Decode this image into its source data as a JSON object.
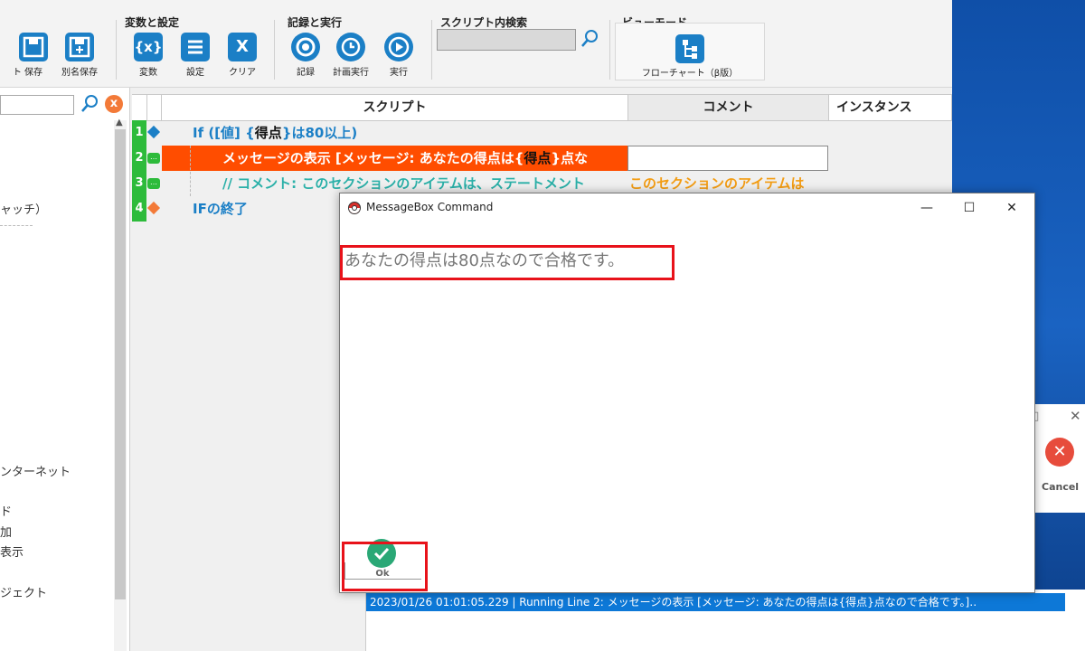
{
  "ribbon": {
    "groups": {
      "variables": "変数と設定",
      "record_run": "記録と実行",
      "search": "スクリプト内検索",
      "view": "ビューモード"
    },
    "buttons": {
      "partial_left": "ト",
      "save": "保存",
      "save_as": "別名保存",
      "variables": "変数",
      "settings": "設定",
      "clear": "クリア",
      "record": "記録",
      "schedule": "計画実行",
      "run": "実行",
      "flowchart": "フローチャート（β版）"
    },
    "icons": {
      "variables": "{x}",
      "clear": "X"
    }
  },
  "left_panel": {
    "items": [
      "ャッチ）",
      "ンターネット",
      "ド",
      "加",
      "表示",
      "ジェクト"
    ]
  },
  "grid": {
    "headers": {
      "script": "スクリプト",
      "comment": "コメント",
      "instance": "インスタンス"
    },
    "rows": [
      {
        "num": "1",
        "text_a": "If ([値] {",
        "text_b": "得点",
        "text_c": "}は80以上)"
      },
      {
        "num": "2",
        "text_a": "メッセージの表示 [メッセージ: あなたの得点は{",
        "text_b": "得点",
        "text_c": "}点な"
      },
      {
        "num": "3",
        "text_a": "// コメント: このセクションのアイテムは、ステートメント",
        "comment": "このセクションのアイテムは"
      },
      {
        "num": "4",
        "text_a": "IFの終了"
      }
    ]
  },
  "message_box": {
    "title": "MessageBox Command",
    "message": "あなたの得点は80点なので合格です。",
    "ok_label": "Ok"
  },
  "background_dialog": {
    "cancel_label": "Cancel"
  },
  "log": {
    "line": "2023/01/26 01:01:05.229 | Running Line 2: メッセージの表示 [メッセージ: あなたの得点は{得点}点なので合格です。]‥"
  },
  "colors": {
    "accent_blue": "#1b7fc6",
    "line_green": "#2dbb3b",
    "highlight_orange": "#ff4d00",
    "comment_teal": "#2ab0a8",
    "annotation_red": "#e8121a"
  }
}
